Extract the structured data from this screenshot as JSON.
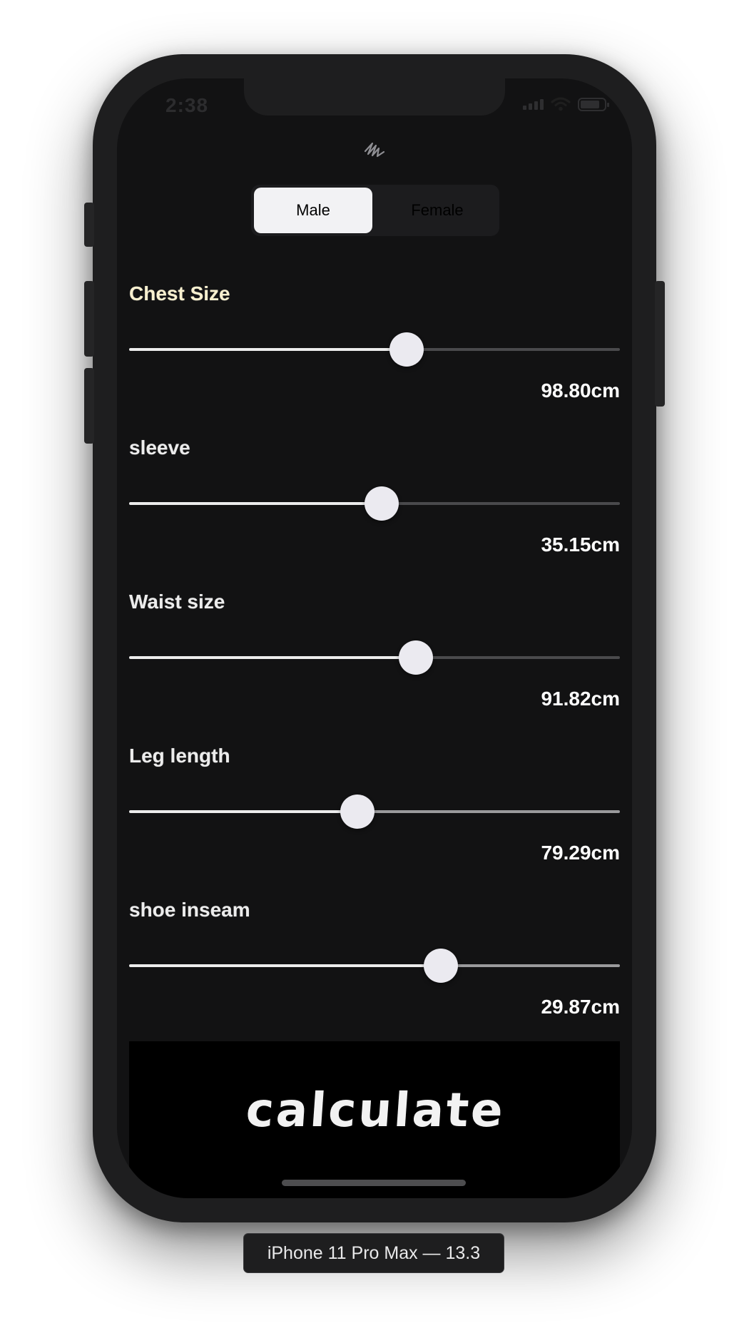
{
  "status_bar": {
    "time": "2:38"
  },
  "app": {
    "logo_icon": "scribble-icon"
  },
  "gender": {
    "options": [
      "Male",
      "Female"
    ],
    "selected": "Male"
  },
  "measurements": [
    {
      "label": "Chest Size",
      "value": "98.80cm",
      "fraction": 0.565,
      "label_color": "#f8f0cf",
      "track_color": "#4a4a4c"
    },
    {
      "label": "sleeve",
      "value": "35.15cm",
      "fraction": 0.514,
      "label_color": "#ececec",
      "track_color": "#4a4a4c"
    },
    {
      "label": "Waist size",
      "value": "91.82cm",
      "fraction": 0.585,
      "label_color": "#ececec",
      "track_color": "#4a4a4c"
    },
    {
      "label": "Leg length",
      "value": "79.29cm",
      "fraction": 0.465,
      "label_color": "#ececec",
      "track_color": "#9a9a9c"
    },
    {
      "label": "shoe inseam",
      "value": "29.87cm",
      "fraction": 0.635,
      "label_color": "#ececec",
      "track_color": "#9a9a9c"
    }
  ],
  "calculate_button": {
    "label": "calculate"
  },
  "device_caption": "iPhone 11 Pro Max — 13.3"
}
